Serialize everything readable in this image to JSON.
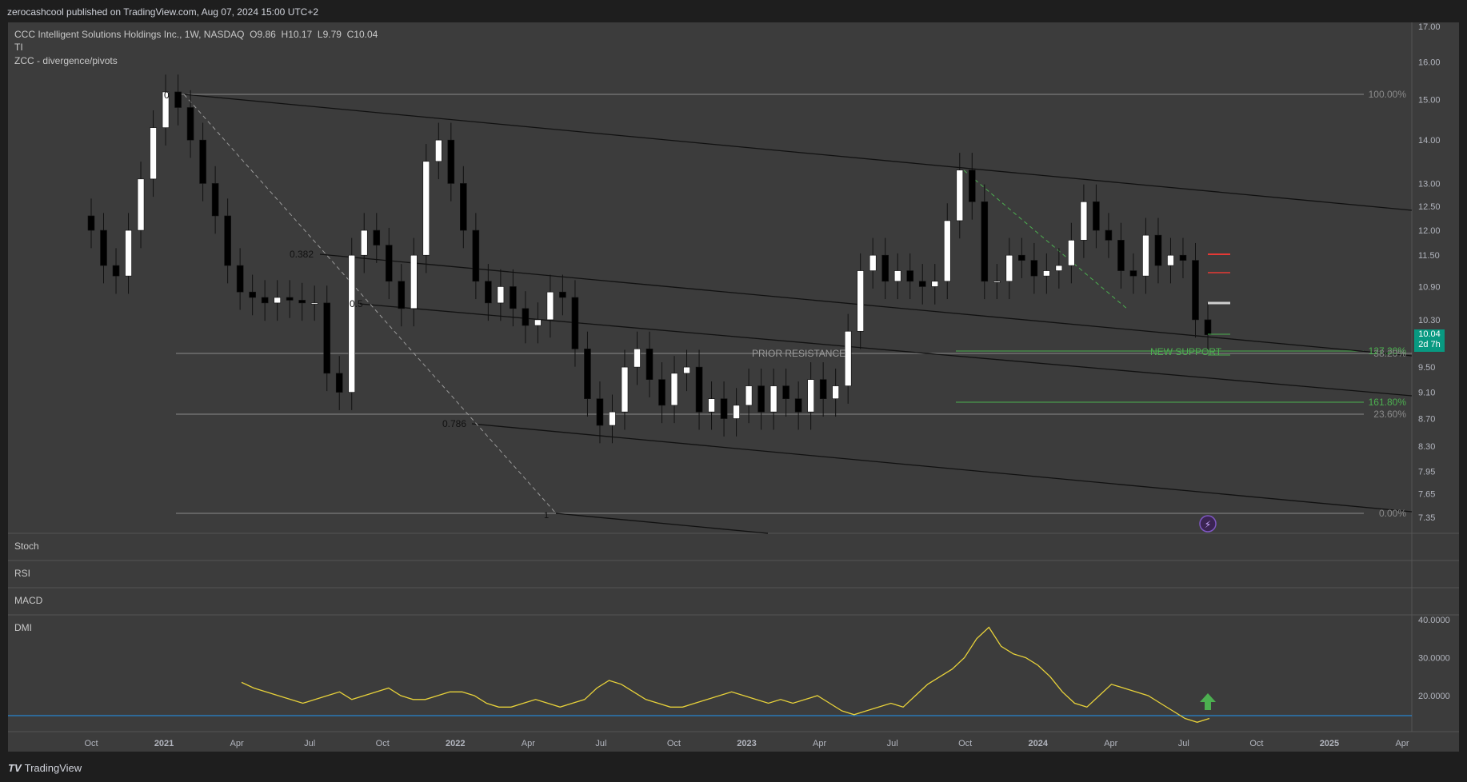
{
  "header": {
    "published": "zerocashcool published on TradingView.com, Aug 07, 2024 15:00 UTC+2"
  },
  "legend": {
    "symbol": "CCC Intelligent Solutions Holdings Inc., 1W, NASDAQ",
    "o_label": "O",
    "o": "9.86",
    "h_label": "H",
    "h": "10.17",
    "l_label": "L",
    "l": "9.79",
    "c_label": "C",
    "c": "10.04",
    "indicator1": "TI",
    "indicator2": "ZCC - divergence/pivots"
  },
  "panes": {
    "stoch": "Stoch",
    "rsi": "RSI",
    "macd": "MACD",
    "dmi": "DMI"
  },
  "price_tag": {
    "price": "10.04",
    "countdown": "2d 7h"
  },
  "annotations": {
    "prior_resistance": "PRIOR RESISTANCE",
    "new_support": "NEW SUPPORT",
    "fib_0382": "0.382",
    "fib_05": "0.5",
    "fib_0786": "0.786",
    "fib_0": "0",
    "fib_1": "1",
    "fib_100": "100.00%",
    "fib_2360": "23.60%",
    "fib_000": "0.00%",
    "fib_1618": "161.80%",
    "fib_1272": "127.20%",
    "fib_382": "38.20%"
  },
  "footer": {
    "brand": "TradingView",
    "logo": "TV"
  },
  "colors": {
    "background": "#3c3c3c",
    "up": "#ffffff",
    "down": "#000000",
    "dmi": "#e8d23a",
    "support": "#4caf50",
    "tag": "#089981"
  },
  "chart_data": {
    "type": "candlestick",
    "title": "",
    "price_axis": [
      "17.00",
      "16.00",
      "15.00",
      "14.00",
      "13.00",
      "12.50",
      "12.00",
      "11.50",
      "10.90",
      "10.30",
      "9.50",
      "9.10",
      "8.70",
      "8.30",
      "7.95",
      "7.65",
      "7.35"
    ],
    "time_axis": [
      "Oct",
      "2021",
      "Apr",
      "Jul",
      "Oct",
      "2022",
      "Apr",
      "Jul",
      "Oct",
      "2023",
      "Apr",
      "Jul",
      "Oct",
      "2024",
      "Apr",
      "Jul",
      "Oct",
      "2025",
      "Apr"
    ],
    "series_close": [
      12.0,
      11.3,
      11.1,
      12.0,
      13.1,
      14.3,
      15.2,
      14.8,
      14.0,
      13.0,
      12.3,
      11.3,
      10.8,
      10.7,
      10.6,
      10.7,
      10.65,
      10.6,
      10.6,
      9.4,
      9.1,
      11.5,
      12.0,
      11.7,
      11.0,
      10.5,
      11.5,
      13.5,
      14.0,
      13.0,
      12.0,
      11.0,
      10.6,
      10.9,
      10.5,
      10.2,
      10.3,
      10.8,
      10.7,
      9.8,
      9.0,
      8.6,
      8.8,
      9.5,
      9.8,
      9.3,
      8.9,
      9.4,
      9.5,
      8.8,
      9.0,
      8.7,
      8.9,
      9.2,
      8.8,
      9.2,
      9.0,
      8.8,
      9.3,
      9.0,
      9.2,
      10.1,
      11.2,
      11.5,
      11.0,
      11.2,
      11.0,
      10.9,
      11.0,
      12.2,
      13.3,
      12.6,
      11.0,
      11.0,
      11.5,
      11.4,
      11.1,
      11.2,
      11.3,
      11.8,
      12.6,
      12.0,
      11.8,
      11.2,
      11.1,
      11.9,
      11.3,
      11.5,
      11.4,
      10.3,
      10.04
    ],
    "dmi": {
      "axis": [
        "40.0000",
        "30.0000",
        "20.0000"
      ],
      "values": [
        23.5,
        22,
        21,
        20,
        19,
        18,
        19,
        20,
        21,
        19,
        20,
        21,
        22,
        20,
        19,
        19,
        20,
        21,
        21,
        20,
        18,
        17,
        17,
        18,
        19,
        18,
        17,
        18,
        19,
        22,
        24,
        23,
        21,
        19,
        18,
        17,
        17,
        18,
        19,
        20,
        21,
        20,
        19,
        18,
        19,
        18,
        19,
        20,
        18,
        16,
        15,
        16,
        17,
        18,
        17,
        20,
        23,
        25,
        27,
        30,
        35,
        38,
        33,
        31,
        30,
        28,
        25,
        21,
        18,
        17,
        20,
        23,
        22,
        21,
        20,
        18,
        16,
        14,
        13,
        14
      ]
    }
  }
}
